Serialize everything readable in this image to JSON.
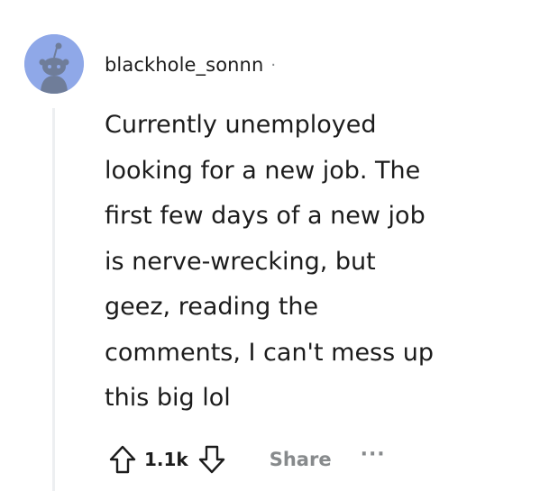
{
  "comment": {
    "username": "blackhole_sonnn",
    "separator": "·",
    "body_lines": "Currently unemployed\nlooking for a new job. The\nfirst few days of a new job\nis nerve-wrecking, but\ngeez, reading the\ncomments, I can't mess up\nthis big lol",
    "avatar_icon": "snoo-avatar-icon",
    "avatar_color": "#8fa8e8"
  },
  "actions": {
    "upvote_icon": "upvote-arrow-icon",
    "score": "1.1k",
    "downvote_icon": "downvote-arrow-icon",
    "share_label": "Share",
    "more_label": "···",
    "more_icon": "more-options-icon"
  },
  "colors": {
    "text_primary": "#1c1c1c",
    "text_muted": "#878a8c",
    "thread_line": "#edeff1"
  }
}
